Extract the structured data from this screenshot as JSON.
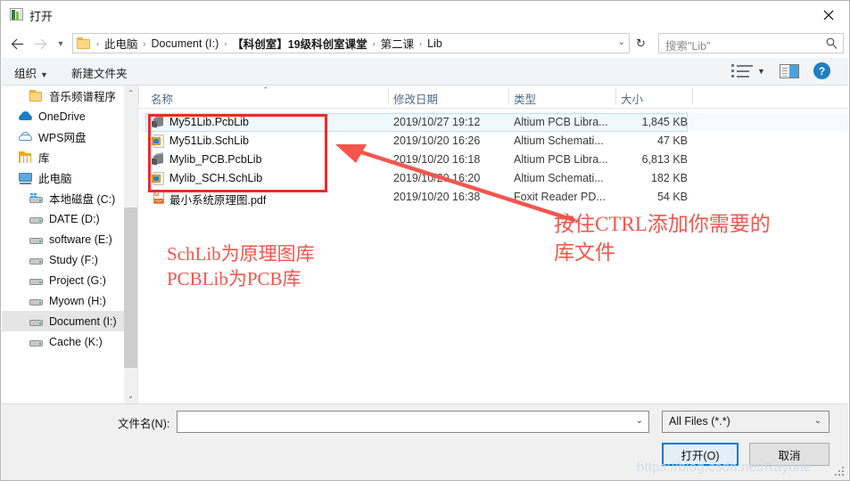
{
  "window": {
    "title": "打开",
    "icon": "app-window-icon",
    "close_label": "✕"
  },
  "nav": {
    "back_icon": "arrow-left-icon",
    "forward_icon": "arrow-right-icon",
    "history_icon": "chevron-down-icon",
    "refresh_icon": "refresh-icon",
    "breadcrumbs": [
      {
        "label": "此电脑",
        "bold": false
      },
      {
        "label": "Document (I:)",
        "bold": false
      },
      {
        "label": "【科创室】19级科创室课堂",
        "bold": true
      },
      {
        "label": "第二课",
        "bold": false
      },
      {
        "label": "Lib",
        "bold": false
      }
    ],
    "separator": "›",
    "address_dropdown_icon": "chevron-down-icon"
  },
  "search": {
    "placeholder": "搜索\"Lib\"",
    "icon": "search-icon"
  },
  "toolbar": {
    "organize_label": "组织",
    "organize_caret": "▼",
    "new_folder_label": "新建文件夹",
    "view_icon": "view-list-icon",
    "view_caret": "▼",
    "preview_pane_icon": "preview-pane-icon",
    "help_label": "?"
  },
  "sidebar": {
    "items": [
      {
        "label": "音乐频谱程序",
        "icon": "folder-icon",
        "indent": true,
        "selected": false
      },
      {
        "label": "OneDrive",
        "icon": "cloud-onedrive-icon",
        "indent": false,
        "selected": false
      },
      {
        "label": "WPS网盘",
        "icon": "cloud-outline-icon",
        "indent": false,
        "selected": false
      },
      {
        "label": "库",
        "icon": "library-icon",
        "indent": false,
        "selected": false
      },
      {
        "label": "此电脑",
        "icon": "this-pc-icon",
        "indent": false,
        "selected": false
      },
      {
        "label": "本地磁盘 (C:)",
        "icon": "drive-system-icon",
        "indent": true,
        "selected": false
      },
      {
        "label": "DATE (D:)",
        "icon": "drive-icon",
        "indent": true,
        "selected": false
      },
      {
        "label": "software (E:)",
        "icon": "drive-icon",
        "indent": true,
        "selected": false
      },
      {
        "label": "Study (F:)",
        "icon": "drive-icon",
        "indent": true,
        "selected": false
      },
      {
        "label": "Project (G:)",
        "icon": "drive-icon",
        "indent": true,
        "selected": false
      },
      {
        "label": "Myown (H:)",
        "icon": "drive-icon",
        "indent": true,
        "selected": false
      },
      {
        "label": "Document (I:)",
        "icon": "drive-icon",
        "indent": true,
        "selected": true
      },
      {
        "label": "Cache (K:)",
        "icon": "drive-icon",
        "indent": true,
        "selected": false
      }
    ],
    "scroll_up_icon": "chevron-up-icon",
    "scroll_down_icon": "chevron-down-icon"
  },
  "filelist": {
    "columns": [
      {
        "label": "名称",
        "sorted": true
      },
      {
        "label": "修改日期",
        "sorted": false
      },
      {
        "label": "类型",
        "sorted": false
      },
      {
        "label": "大小",
        "sorted": false
      }
    ],
    "sort_indicator": "⌃",
    "rows": [
      {
        "name": "My51Lib.PcbLib",
        "date": "2019/10/27 19:12",
        "type": "Altium PCB Libra...",
        "size": "1,845 KB",
        "icon": "pcblib-file-icon",
        "selected": true
      },
      {
        "name": "My51Lib.SchLib",
        "date": "2019/10/20 16:26",
        "type": "Altium Schemati...",
        "size": "47 KB",
        "icon": "schlib-file-icon",
        "selected": false
      },
      {
        "name": "Mylib_PCB.PcbLib",
        "date": "2019/10/20 16:18",
        "type": "Altium PCB Libra...",
        "size": "6,813 KB",
        "icon": "pcblib-file-icon",
        "selected": false
      },
      {
        "name": "Mylib_SCH.SchLib",
        "date": "2019/10/20 16:20",
        "type": "Altium Schemati...",
        "size": "182 KB",
        "icon": "schlib-file-icon",
        "selected": false
      },
      {
        "name": "最小系统原理图.pdf",
        "date": "2019/10/20 16:38",
        "type": "Foxit Reader PD...",
        "size": "54 KB",
        "icon": "pdf-file-icon",
        "selected": false
      }
    ]
  },
  "annotations": {
    "color": "#f5554d",
    "box_color": "#ef2929",
    "left_note": "SchLib为原理图库\nPCBLib为PCB库",
    "right_note": "按住CTRL添加你需要的\n库文件",
    "arrow": "red-arrow-pointing-to-file-list"
  },
  "bottom": {
    "filename_label": "文件名(N):",
    "filename_value": "",
    "filename_dropdown_icon": "chevron-down-icon",
    "filter_value": "All Files (*.*)",
    "filter_dropdown_icon": "chevron-down-icon",
    "open_button": "打开(O)",
    "cancel_button": "取消"
  },
  "watermark": {
    "text": "https://blog.csdn.net/Rayone"
  }
}
